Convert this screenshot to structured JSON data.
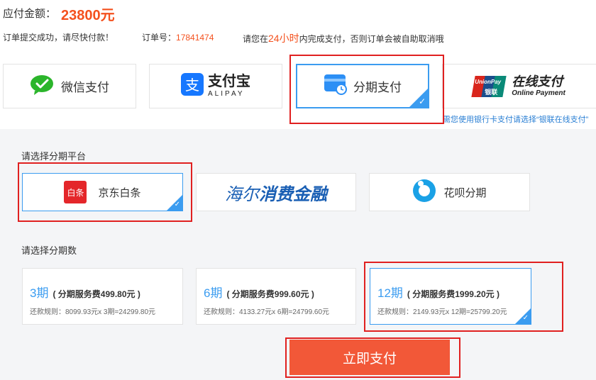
{
  "header": {
    "amount_label": "应付金额：",
    "amount_value": "23800元",
    "notice_success": "订单提交成功，请尽快付款！",
    "order_label": "订单号：",
    "order_number": "17841474",
    "deadline_prefix": "请您在",
    "deadline_hours": "24小时",
    "deadline_suffix": "内完成支付，否则订单会被自助取消哦"
  },
  "pay_methods": [
    {
      "label": "微信支付"
    },
    {
      "label": "支付宝",
      "sub": "ALIPAY"
    },
    {
      "label": "分期支付",
      "selected": true
    },
    {
      "label": "在线支付",
      "sub": "Online Payment",
      "logo_top": "UnionPay",
      "logo_bottom": "银联"
    }
  ],
  "unionpay_hint": "需您使用银行卡支付请选择“银联在线支付”",
  "platform_section": {
    "title": "请选择分期平台",
    "platforms": [
      {
        "label": "京东白条",
        "logo_text": "白条",
        "selected": true
      },
      {
        "label": "海尔消费金融",
        "logo_a": "海尔",
        "logo_b": "消费金融"
      },
      {
        "label": "花呗分期"
      }
    ]
  },
  "installment_section": {
    "title": "请选择分期数",
    "options": [
      {
        "period": "3期",
        "fee": "( 分期服务费499.80元 )",
        "rule": "还款规则：8099.93元x 3期=24299.80元"
      },
      {
        "period": "6期",
        "fee": "( 分期服务费999.60元 )",
        "rule": "还款规则：4133.27元x 6期=24799.60元"
      },
      {
        "period": "12期",
        "fee": "( 分期服务费1999.20元 )",
        "rule": "还款规则：2149.93元x 12期=25799.20元",
        "selected": true
      }
    ]
  },
  "submit_label": "立即支付",
  "colors": {
    "accent": "#f4511e",
    "selected": "#3b9cf0",
    "button": "#f25838",
    "annotation": "#e02020"
  }
}
